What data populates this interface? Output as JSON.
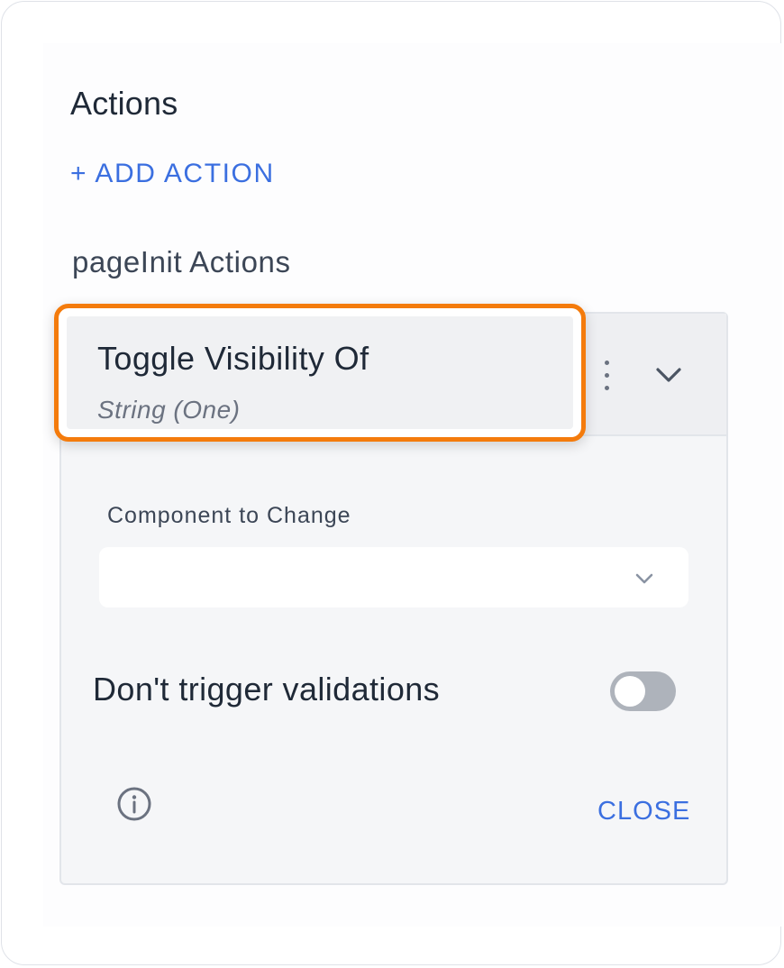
{
  "actions": {
    "title": "Actions",
    "add_action_label": "+ ADD ACTION",
    "section_title": "pageInit Actions"
  },
  "action_card": {
    "title": "Toggle Visibility Of",
    "subtitle": "String (One)",
    "menu_icon": "kebab-vertical-icon",
    "expand_icon": "chevron-down-icon",
    "field_label": "Component to Change",
    "field_value": "",
    "toggle_label": "Don't trigger validations",
    "toggle_on": false,
    "info_icon": "info-circle-icon",
    "close_label": "CLOSE"
  },
  "colors": {
    "accent": "#3b6fe0",
    "highlight": "#f47b0c",
    "text": "#1f2937",
    "muted": "#6b7280"
  }
}
